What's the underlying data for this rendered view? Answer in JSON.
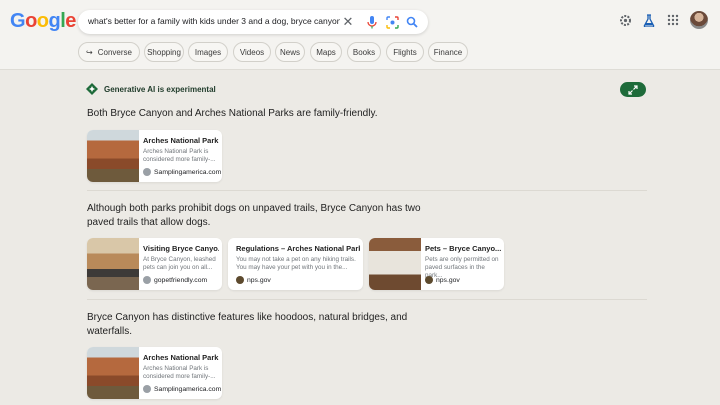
{
  "header": {
    "logo": [
      "G",
      "o",
      "o",
      "g",
      "l",
      "e"
    ],
    "query": "what's better for a family with kids under 3 and a dog, bryce canyon or",
    "icons": [
      "close-icon",
      "mic-icon",
      "lens-icon",
      "search-icon",
      "gear-icon",
      "labs-icon",
      "apps-icon"
    ]
  },
  "chips": [
    "Converse",
    "Shopping",
    "Images",
    "Videos",
    "News",
    "Maps",
    "Books",
    "Flights",
    "Finance"
  ],
  "ai": {
    "label": "Generative AI is experimental"
  },
  "sections": [
    {
      "text": [
        "Both Bryce Canyon and Arches National Parks are family-friendly."
      ],
      "cards": [
        {
          "title": "Arches National Park...",
          "snippet": [
            "Arches National Park is",
            "considered more family-..."
          ],
          "source": "Samplingamerica.com"
        }
      ]
    },
    {
      "text": [
        "Although both parks prohibit dogs on unpaved trails, Bryce Canyon has two",
        "paved trails that allow dogs."
      ],
      "cards": [
        {
          "title": "Visiting Bryce Canyo...",
          "snippet": [
            "At Bryce Canyon, leashed",
            "pets can join you on all..."
          ],
          "source": "gopetfriendly.com"
        },
        {
          "title": "Regulations – Arches National Park",
          "snippet": [
            "You may not take a pet on any hiking trails.",
            "You may have your pet with you in the..."
          ],
          "source": "nps.gov"
        },
        {
          "title": "Pets – Bryce Canyo...",
          "snippet": [
            "Pets are only permitted on",
            "paved surfaces in the park..."
          ],
          "source": "nps.gov"
        }
      ]
    },
    {
      "text": [
        "Bryce Canyon has distinctive features like hoodoos, natural bridges, and",
        "waterfalls."
      ],
      "cards": [
        {
          "title": "Arches National Park...",
          "snippet": [
            "Arches National Park is",
            "considered more family-..."
          ],
          "source": "Samplingamerica.com"
        }
      ]
    }
  ],
  "colors": {
    "accent": "#1e6b3a",
    "background": "#eceae5"
  }
}
